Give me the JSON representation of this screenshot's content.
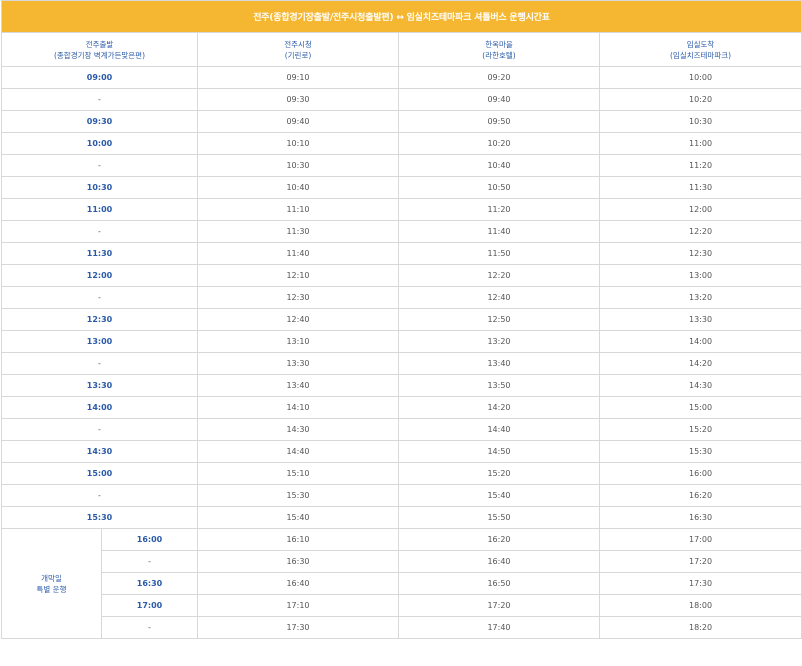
{
  "title": "전주(종합경기장출발/전주시청출발편) ↔ 임실치즈테마파크 셔틀버스 운행시간표",
  "columns": [
    {
      "line1": "전주출발",
      "line2": "(종합경기장 벽계가든맞은편)"
    },
    {
      "line1": "전주시청",
      "line2": "(기린로)"
    },
    {
      "line1": "한옥마을",
      "line2": "(라한호텔)"
    },
    {
      "line1": "임실도착",
      "line2": "(임실치즈테마파크)"
    }
  ],
  "rows": [
    [
      "09:00",
      "09:10",
      "09:20",
      "10:00"
    ],
    [
      "-",
      "09:30",
      "09:40",
      "10:20"
    ],
    [
      "09:30",
      "09:40",
      "09:50",
      "10:30"
    ],
    [
      "10:00",
      "10:10",
      "10:20",
      "11:00"
    ],
    [
      "-",
      "10:30",
      "10:40",
      "11:20"
    ],
    [
      "10:30",
      "10:40",
      "10:50",
      "11:30"
    ],
    [
      "11:00",
      "11:10",
      "11:20",
      "12:00"
    ],
    [
      "-",
      "11:30",
      "11:40",
      "12:20"
    ],
    [
      "11:30",
      "11:40",
      "11:50",
      "12:30"
    ],
    [
      "12:00",
      "12:10",
      "12:20",
      "13:00"
    ],
    [
      "-",
      "12:30",
      "12:40",
      "13:20"
    ],
    [
      "12:30",
      "12:40",
      "12:50",
      "13:30"
    ],
    [
      "13:00",
      "13:10",
      "13:20",
      "14:00"
    ],
    [
      "-",
      "13:30",
      "13:40",
      "14:20"
    ],
    [
      "13:30",
      "13:40",
      "13:50",
      "14:30"
    ],
    [
      "14:00",
      "14:10",
      "14:20",
      "15:00"
    ],
    [
      "-",
      "14:30",
      "14:40",
      "15:20"
    ],
    [
      "14:30",
      "14:40",
      "14:50",
      "15:30"
    ],
    [
      "15:00",
      "15:10",
      "15:20",
      "16:00"
    ],
    [
      "-",
      "15:30",
      "15:40",
      "16:20"
    ],
    [
      "15:30",
      "15:40",
      "15:50",
      "16:30"
    ]
  ],
  "special": {
    "label_line1": "개막일",
    "label_line2": "특별 운행",
    "rows": [
      [
        "16:00",
        "16:10",
        "16:20",
        "17:00"
      ],
      [
        "-",
        "16:30",
        "16:40",
        "17:20"
      ],
      [
        "16:30",
        "16:40",
        "16:50",
        "17:30"
      ],
      [
        "17:00",
        "17:10",
        "17:20",
        "18:00"
      ],
      [
        "-",
        "17:30",
        "17:40",
        "18:20"
      ]
    ]
  },
  "colors": {
    "header_bg": "#f5b731",
    "accent_text": "#2a5aa8",
    "body_text": "#555555",
    "border": "#d8d8d8"
  }
}
